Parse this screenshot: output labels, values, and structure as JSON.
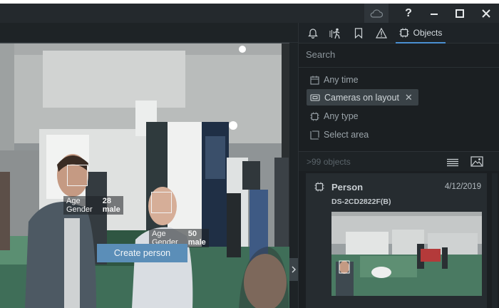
{
  "titlebar": {
    "icons": [
      "cloud-icon",
      "help-icon",
      "minimize-icon",
      "maximize-icon",
      "close-icon"
    ],
    "help_label": "?"
  },
  "video": {
    "detections": [
      {
        "attr1_label": "Age",
        "attr1_value": "28",
        "attr2_label": "Gender",
        "attr2_value": "male"
      },
      {
        "attr1_label": "Age",
        "attr1_value": "50",
        "attr2_label": "Gender",
        "attr2_value": "male"
      }
    ]
  },
  "panel": {
    "tabs": [
      {
        "icon": "bell-icon"
      },
      {
        "icon": "motion-icon"
      },
      {
        "icon": "bookmark-icon"
      },
      {
        "icon": "alert-icon"
      },
      {
        "icon": "objects-icon",
        "label": "Objects",
        "active": true
      }
    ],
    "search_placeholder": "Search",
    "filters": {
      "time": "Any time",
      "cameras": "Cameras on layout",
      "type": "Any type",
      "area": "Select area"
    },
    "results_count": ">99 objects",
    "card": {
      "title": "Person",
      "date": "4/12/2019",
      "camera": "DS-2CD2822F(B)",
      "button": "Create person"
    }
  },
  "colors": {
    "accent": "#4a8fd1",
    "button": "#5b8eb8",
    "panel_bg": "#1b1f22"
  }
}
